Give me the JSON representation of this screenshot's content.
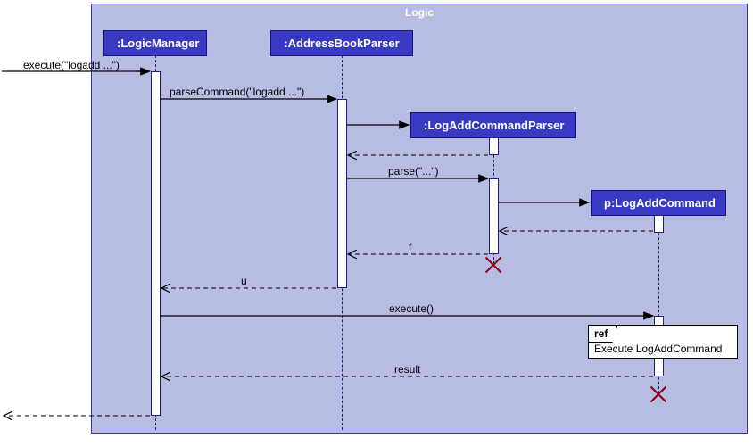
{
  "frame": {
    "title": "Logic"
  },
  "participants": {
    "p1": ":LogicManager",
    "p2": ":AddressBookParser",
    "p3": ":LogAddCommandParser",
    "p4": "p:LogAddCommand"
  },
  "messages": {
    "m1": "execute(\"logadd ...\")",
    "m2": "parseCommand(\"logadd ...\")",
    "m3": "parse(\"...\")",
    "m4": "f",
    "m5": "u",
    "m6": "execute()",
    "m7": "result"
  },
  "ref": {
    "label": "ref",
    "text": "Execute LogAddCommand"
  },
  "chart_data": {
    "type": "uml-sequence",
    "frame": "Logic",
    "participants": [
      {
        "id": "lm",
        "name": ":LogicManager",
        "created_at": 0
      },
      {
        "id": "abp",
        "name": ":AddressBookParser",
        "created_at": 0
      },
      {
        "id": "lacp",
        "name": ":LogAddCommandParser",
        "created_at": 3,
        "destroyed_at": 8
      },
      {
        "id": "lac",
        "name": "p:LogAddCommand",
        "created_at": 5,
        "destroyed_at": 13
      }
    ],
    "events": [
      {
        "n": 1,
        "from": "external",
        "to": "lm",
        "type": "call",
        "label": "execute(\"logadd ...\")"
      },
      {
        "n": 2,
        "from": "lm",
        "to": "abp",
        "type": "call",
        "label": "parseCommand(\"logadd ...\")"
      },
      {
        "n": 3,
        "from": "abp",
        "to": "lacp",
        "type": "create",
        "label": ""
      },
      {
        "n": 4,
        "from": "lacp",
        "to": "abp",
        "type": "return",
        "label": ""
      },
      {
        "n": 5,
        "from": "abp",
        "to": "lacp",
        "type": "call",
        "label": "parse(\"...\")"
      },
      {
        "n": 6,
        "from": "lacp",
        "to": "lac",
        "type": "create",
        "label": ""
      },
      {
        "n": 7,
        "from": "lac",
        "to": "lacp",
        "type": "return",
        "label": ""
      },
      {
        "n": 8,
        "from": "lacp",
        "to": "abp",
        "type": "return",
        "label": "f"
      },
      {
        "n": 9,
        "from": "abp",
        "to": "lm",
        "type": "return",
        "label": "u"
      },
      {
        "n": 10,
        "from": "lm",
        "to": "lac",
        "type": "call",
        "label": "execute()"
      },
      {
        "n": 11,
        "type": "ref",
        "over": [
          "lac"
        ],
        "label": "Execute LogAddCommand"
      },
      {
        "n": 12,
        "from": "lac",
        "to": "lm",
        "type": "return",
        "label": "result"
      },
      {
        "n": 13,
        "from": "lm",
        "to": "external",
        "type": "return",
        "label": ""
      }
    ]
  }
}
